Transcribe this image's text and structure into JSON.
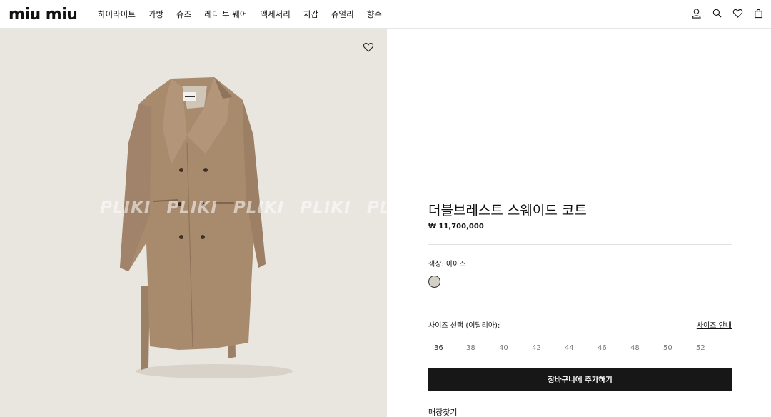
{
  "header": {
    "brand": "miu miu",
    "nav": [
      "하이라이트",
      "가방",
      "슈즈",
      "레디 투 웨어",
      "액세서리",
      "지갑",
      "쥬얼리",
      "향수"
    ],
    "icons": [
      "user-icon",
      "search-icon",
      "heart-icon",
      "bag-icon"
    ]
  },
  "gallery": {
    "watermark": [
      "PLIKI",
      "PLIKI",
      "PLIKI",
      "PLIKI",
      "PLI"
    ],
    "wishlist_icon": "heart-icon"
  },
  "product": {
    "title": "더블브레스트 스웨이드 코트",
    "price": "₩ 11,700,000",
    "color_label": "색상:  아이스",
    "color_swatch": "#d4d0c8",
    "size_label": "사이즈 선택 (이탈리아):",
    "size_guide": "사이즈 안내",
    "sizes": [
      {
        "label": "36",
        "available": true
      },
      {
        "label": "38",
        "available": false
      },
      {
        "label": "40",
        "available": false
      },
      {
        "label": "42",
        "available": false
      },
      {
        "label": "44",
        "available": false
      },
      {
        "label": "46",
        "available": false
      },
      {
        "label": "48",
        "available": false
      },
      {
        "label": "50",
        "available": false
      },
      {
        "label": "52",
        "available": false
      }
    ],
    "add_to_cart": "장바구니에 추가하기",
    "store_finder": "매장찾기"
  }
}
